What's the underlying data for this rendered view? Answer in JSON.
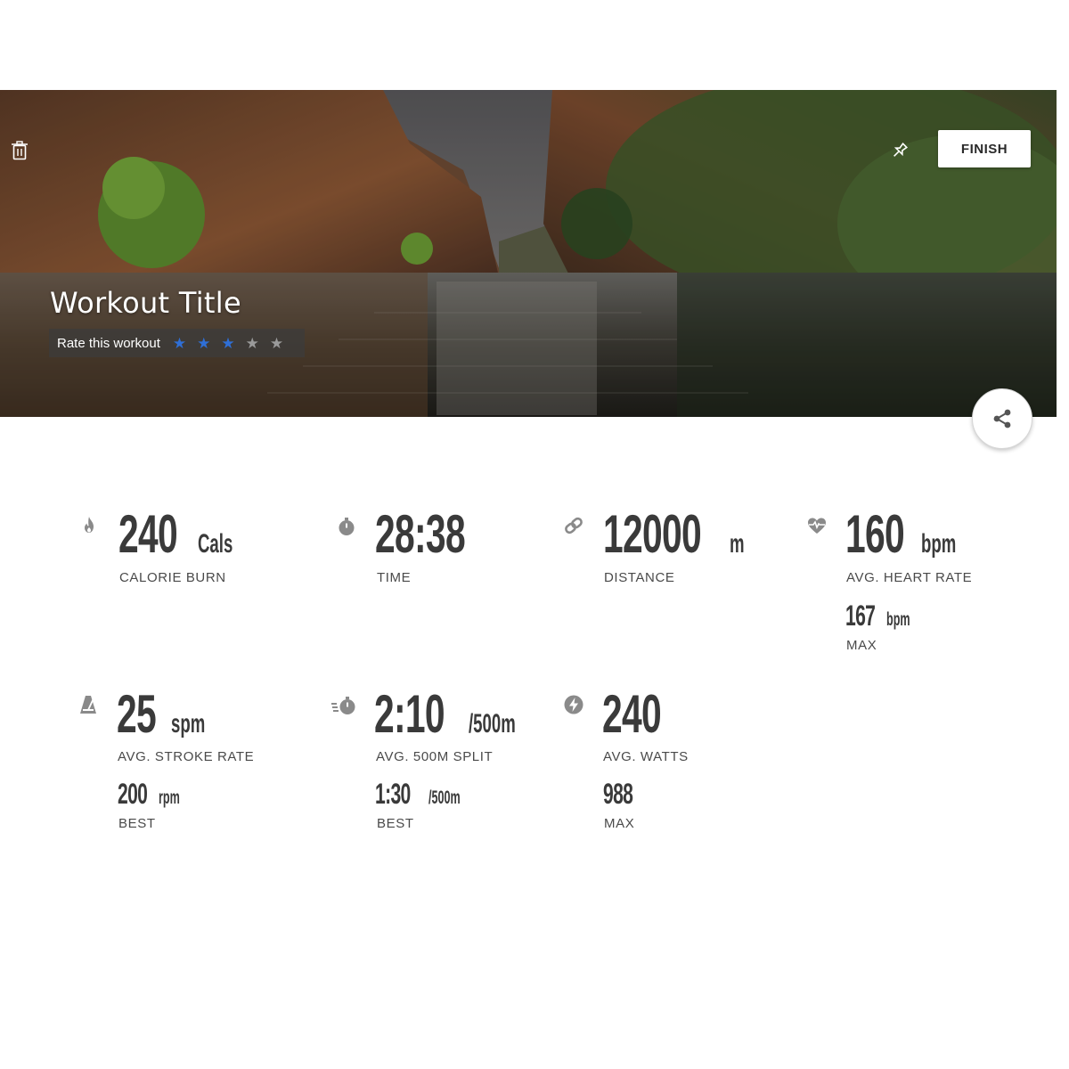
{
  "hero": {
    "title": "Workout Title",
    "rate_label": "Rate this workout",
    "rating": 3,
    "rating_max": 5,
    "finish_label": "FINISH",
    "icons": {
      "delete": "trash-icon",
      "pin": "pin-icon",
      "share": "share-icon"
    }
  },
  "stats": {
    "calories": {
      "value": "240",
      "unit": "Cals",
      "label": "CALORIE BURN",
      "icon": "flame-icon"
    },
    "time": {
      "value": "28:38",
      "label": "TIME",
      "icon": "stopwatch-icon"
    },
    "distance": {
      "value": "12000",
      "unit": "m",
      "label": "DISTANCE",
      "icon": "link-icon"
    },
    "heart_rate": {
      "value": "160",
      "unit": "bpm",
      "label": "AVG. HEART RATE",
      "icon": "heart-rate-icon",
      "secondary": {
        "value": "167",
        "unit": "bpm",
        "label": "MAX"
      }
    },
    "stroke_rate": {
      "value": "25",
      "unit": "spm",
      "label": "AVG. STROKE RATE",
      "icon": "metronome-icon",
      "secondary": {
        "value": "200",
        "unit": "rpm",
        "label": "BEST"
      }
    },
    "split": {
      "value": "2:10",
      "unit": "/500m",
      "label": "AVG. 500M SPLIT",
      "icon": "fast-stopwatch-icon",
      "secondary": {
        "value": "1:30",
        "unit": "/500m",
        "label": "BEST"
      }
    },
    "watts": {
      "value": "240",
      "label": "AVG. WATTS",
      "icon": "bolt-icon",
      "secondary": {
        "value": "988",
        "label": "MAX"
      }
    }
  },
  "colors": {
    "star_filled": "#2f6fd6",
    "star_empty": "#9a9a9a",
    "text_dark": "#3a3a3a",
    "icon_gray": "#8a8a8a"
  }
}
